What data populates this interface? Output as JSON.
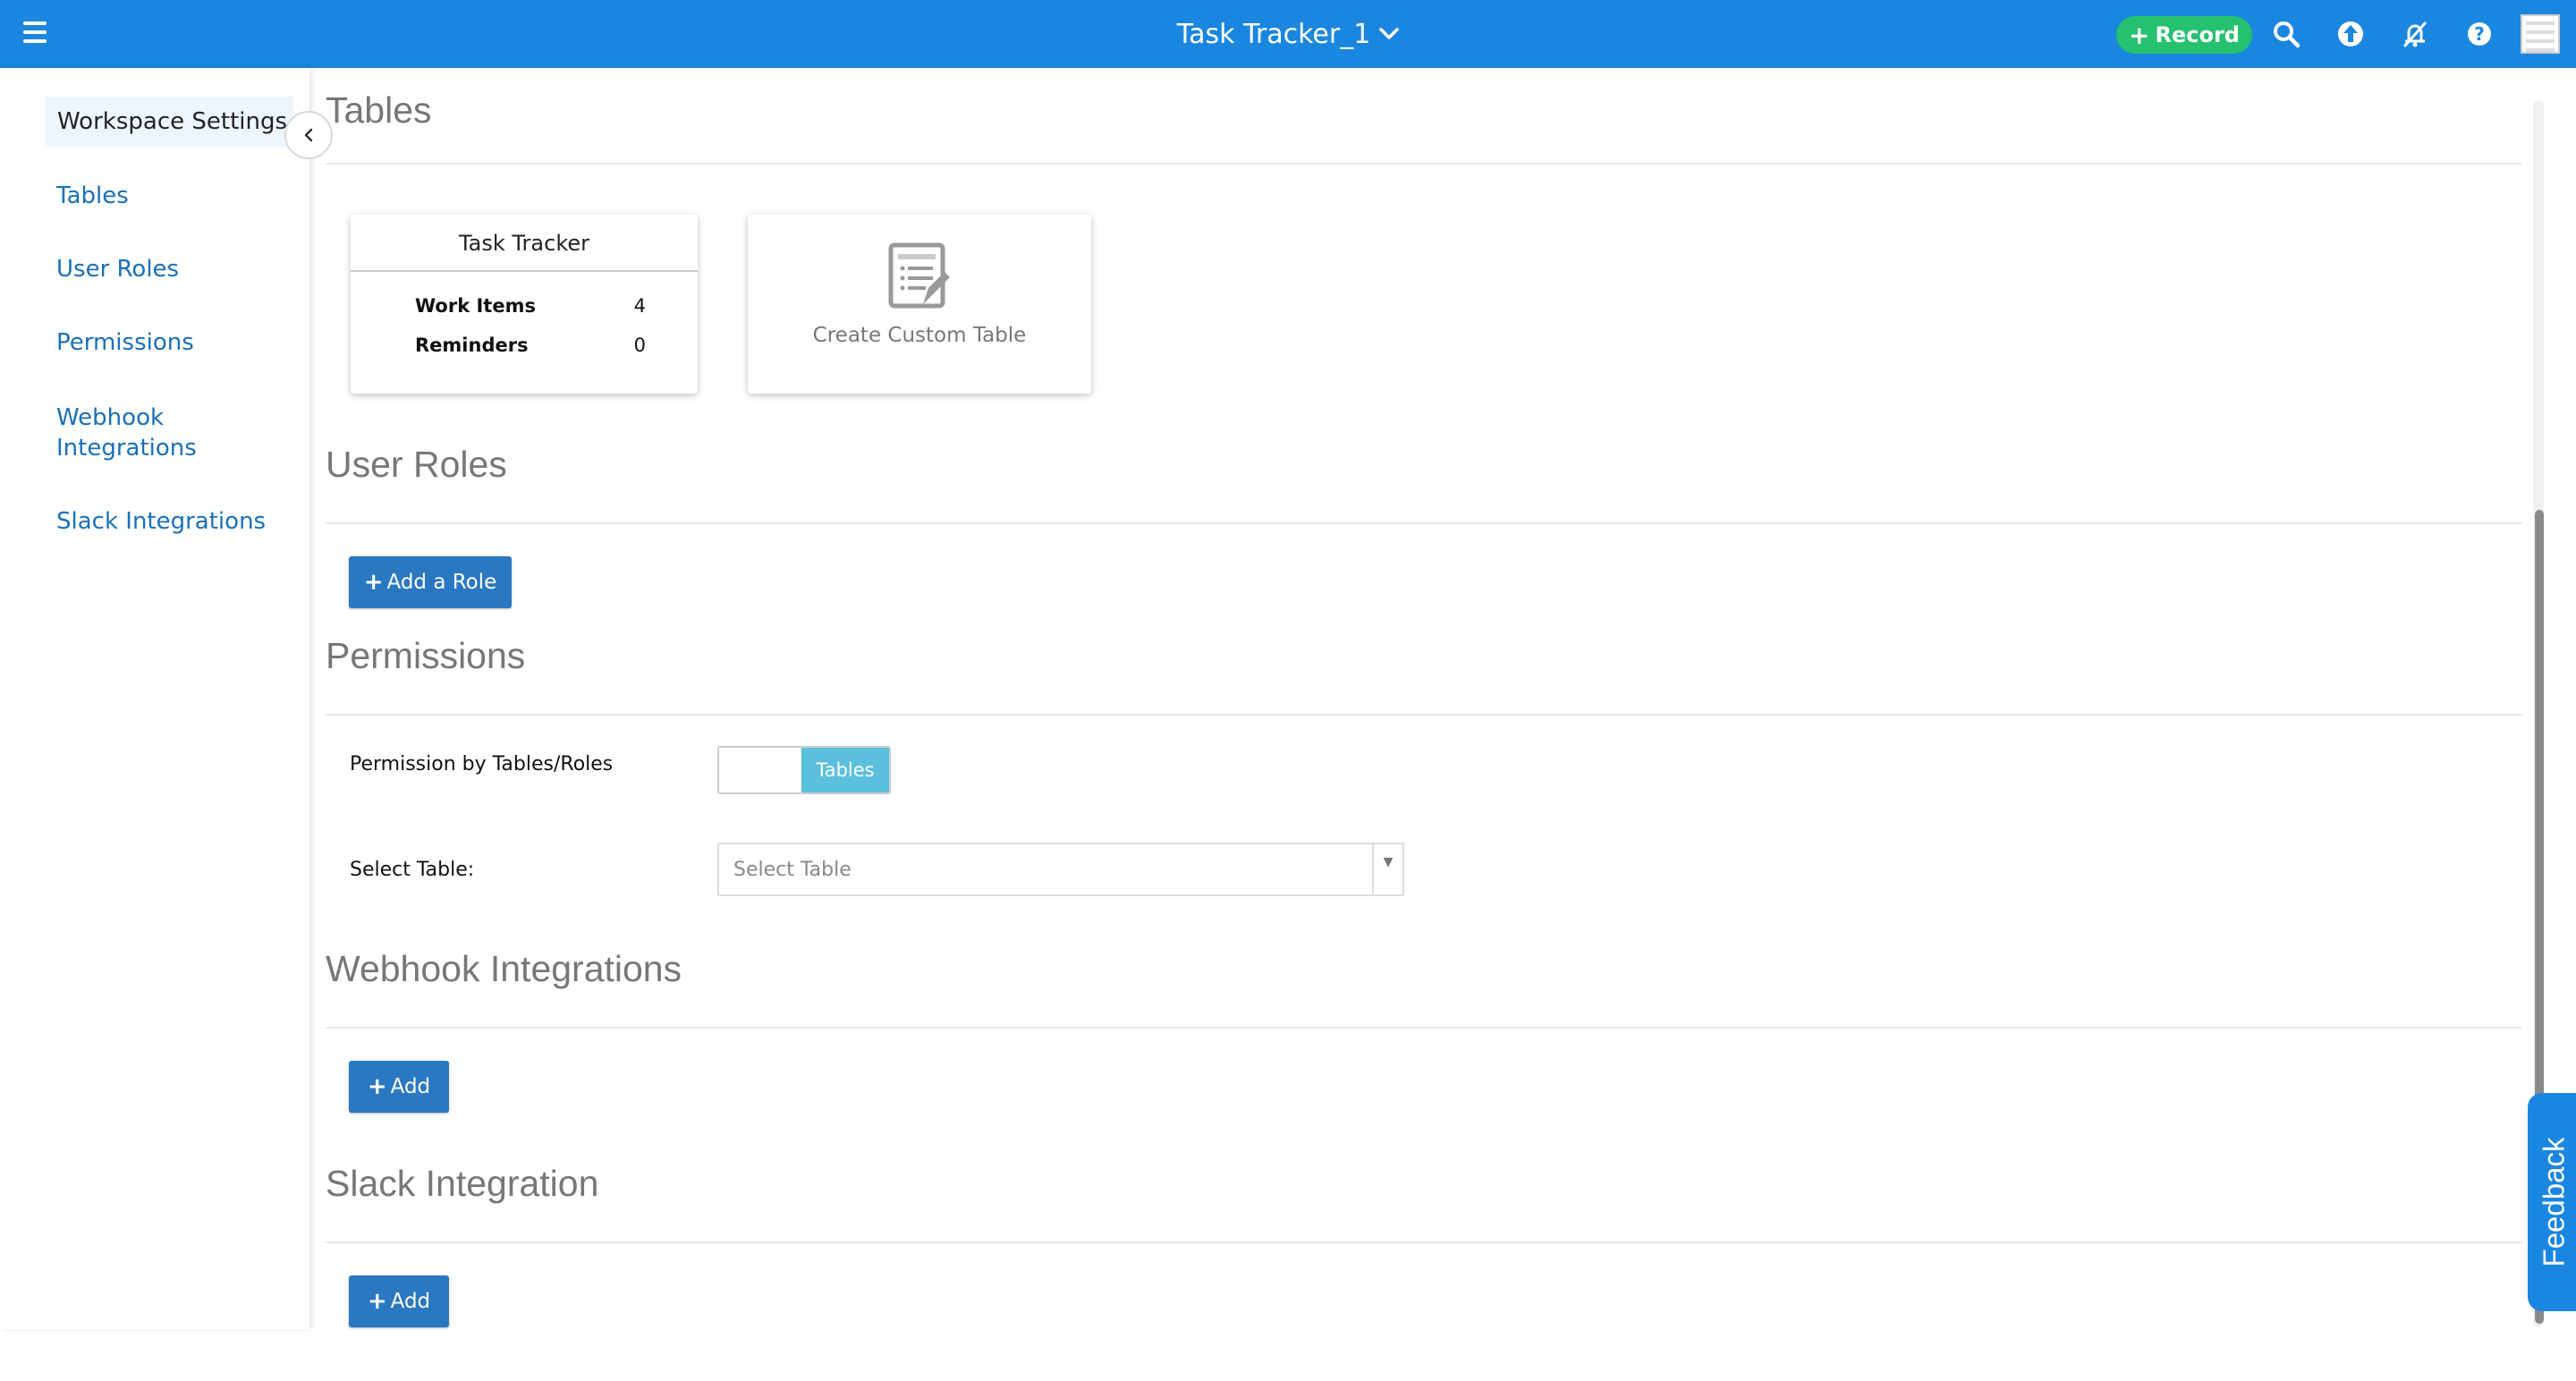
{
  "header": {
    "title": "Task Tracker_1",
    "record_label": "Record",
    "icons": [
      "menu-icon",
      "chevron-down-icon",
      "search-icon",
      "upload-icon",
      "notifications-off-icon",
      "help-icon",
      "avatar"
    ]
  },
  "sidebar": {
    "heading": "Workspace Settings",
    "items": [
      {
        "label": "Tables"
      },
      {
        "label": "User Roles"
      },
      {
        "label": "Permissions"
      },
      {
        "label": "Webhook Integrations"
      },
      {
        "label": "Slack Integrations"
      }
    ]
  },
  "tables_section": {
    "title": "Tables",
    "card": {
      "title": "Task Tracker",
      "rows": [
        {
          "label": "Work Items",
          "value": "4"
        },
        {
          "label": "Reminders",
          "value": "0"
        }
      ]
    },
    "custom_card_label": "Create Custom Table"
  },
  "user_roles_section": {
    "title": "User Roles",
    "button_label": "Add a Role"
  },
  "permissions_section": {
    "title": "Permissions",
    "toggle_label": "Permission by Tables/Roles",
    "toggle_value": "Tables",
    "select_label": "Select Table:",
    "select_placeholder": "Select Table"
  },
  "webhook_section": {
    "title": "Webhook Integrations",
    "button_label": "Add"
  },
  "slack_section": {
    "title": "Slack Integration",
    "button_label": "Add"
  },
  "feedback_label": "Feedback",
  "colors": {
    "topbar": "#1a86e0",
    "record": "#25c16f",
    "primary_button": "#2a78c2",
    "toggle_on": "#5bc0de",
    "sidebar_link": "#1a70b8"
  }
}
